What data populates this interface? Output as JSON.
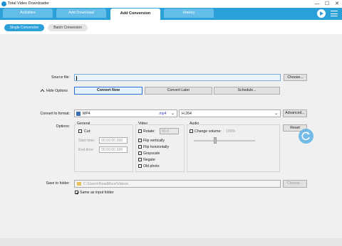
{
  "window": {
    "title": "Total Video Downloader",
    "controls": {
      "minimize": "—",
      "maximize": "☐",
      "close": "✕"
    }
  },
  "tabs": [
    {
      "label": "Activities"
    },
    {
      "label": "Add Download"
    },
    {
      "label": "Add Conversion"
    },
    {
      "label": "History"
    }
  ],
  "modes": {
    "single": "Single Conversion",
    "batch": "Batch Conversion"
  },
  "form": {
    "source_label": "Source file:",
    "source_value": "",
    "choose_label": "Choose...",
    "hide_options": "Hide Options",
    "convert_now": "Convert Now",
    "convert_later": "Convert Later",
    "schedule": "Schedule...",
    "convert_to_label": "Convert to format:",
    "format_value": "MP4",
    "format_ext": ".mp4",
    "codec_value": "H.264",
    "advanced_label": "Advanced...",
    "options_label": "Options:",
    "reset_label": "Reset",
    "general": {
      "title": "General",
      "cut_label": "Cut:",
      "start_label": "Start time:",
      "start_value": "00:00:00.000",
      "end_label": "End time:",
      "end_value": "00:00:00.000"
    },
    "video": {
      "title": "Video",
      "rotate_label": "Rotate:",
      "rotate_value": "90.0",
      "items": [
        "Flip vertically",
        "Flip horizontally",
        "Grayscale",
        "Negate",
        "Old photo"
      ]
    },
    "audio": {
      "title": "Audio",
      "volume_label": "Change volume:",
      "volume_value": "100%",
      "volume_level": 0.35
    },
    "save_label": "Save to folder:",
    "save_path": "C:\\Users\\ReadMore\\Videos",
    "save_choose": "Choose...",
    "same_input": "Same as input folder",
    "same_input_checked": true
  },
  "colors": {
    "accent": "#2a9fd8",
    "tab_inactive": "#63bde8",
    "button_active_border": "#2a6fd6"
  },
  "icons": {
    "app": "app-logo-icon",
    "play": "play-icon",
    "menu": "hamburger-menu-icon",
    "hide": "chevron-up-icon",
    "refresh": "refresh-icon"
  }
}
